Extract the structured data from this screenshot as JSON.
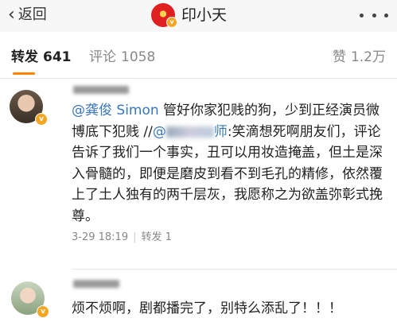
{
  "header": {
    "back_label": "返回",
    "title": "印小天",
    "more_icon": "more-dots-icon"
  },
  "tabs": {
    "repost_label": "转发",
    "repost_count": "641",
    "comment_label": "评论",
    "comment_count": "1058",
    "like_label": "赞",
    "like_count": "1.2万"
  },
  "reposts": [
    {
      "mention": "@龚俊 Simon",
      "text_a": " 管好你家犯贱的狗，少到正经演员微博底下犯贱 //",
      "mention2_prefix": "@",
      "mention2_suffix": "师",
      "text_b": ":笑滴想死啊朋友们，评论告诉了我们一个事实，丑可以用妆造掩盖，但土是深入骨髓的，即便是磨皮到看不到毛孔的精修，依然覆上了土人独有的两千层灰，我愿称之为欲盖弥彰式挽尊。",
      "time": "3-29 18:19",
      "repost_label": "转发 1"
    },
    {
      "text": "烦不烦啊，剧都播完了，别特么添乱了！！！"
    }
  ],
  "colors": {
    "accent": "#ff8200",
    "link": "#3877bb",
    "badge": "#f5a623"
  }
}
